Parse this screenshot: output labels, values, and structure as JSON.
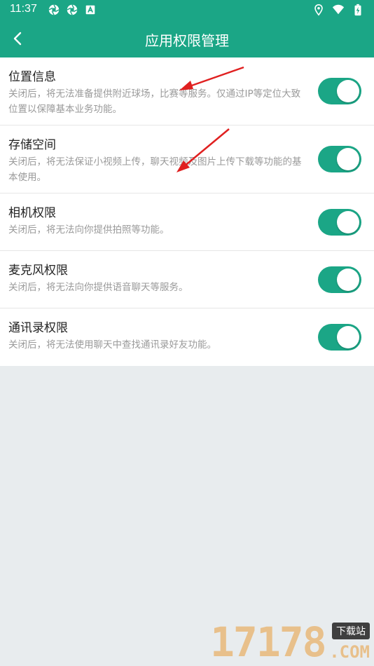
{
  "status_bar": {
    "time": "11:37",
    "left_icons": [
      "aperture-icon",
      "aperture-icon",
      "notification-a-icon"
    ],
    "right_icons": [
      "location-icon",
      "wifi-icon",
      "battery-charging-icon"
    ]
  },
  "header": {
    "title": "应用权限管理",
    "back_icon": "chevron-left-icon",
    "background": "#1ba686"
  },
  "permissions": [
    {
      "title": "位置信息",
      "description": "关闭后，将无法准备提供附近球场，比赛等服务。仅通过IP等定位大致位置以保障基本业务功能。",
      "enabled": true
    },
    {
      "title": "存储空间",
      "description": "关闭后，将无法保证小视频上传，聊天视频及图片上传下载等功能的基本使用。",
      "enabled": true
    },
    {
      "title": "相机权限",
      "description": "关闭后，将无法向你提供拍照等功能。",
      "enabled": true
    },
    {
      "title": "麦克风权限",
      "description": "关闭后，将无法向你提供语音聊天等服务。",
      "enabled": true
    },
    {
      "title": "通讯录权限",
      "description": "关闭后，将无法使用聊天中查找通讯录好友功能。",
      "enabled": true
    }
  ],
  "watermark": {
    "digits": "17178",
    "badge": "下载站",
    "suffix": ".COM"
  },
  "colors": {
    "accent": "#1ba686",
    "background": "#e8ecee",
    "annotation_arrow": "#e02020"
  }
}
